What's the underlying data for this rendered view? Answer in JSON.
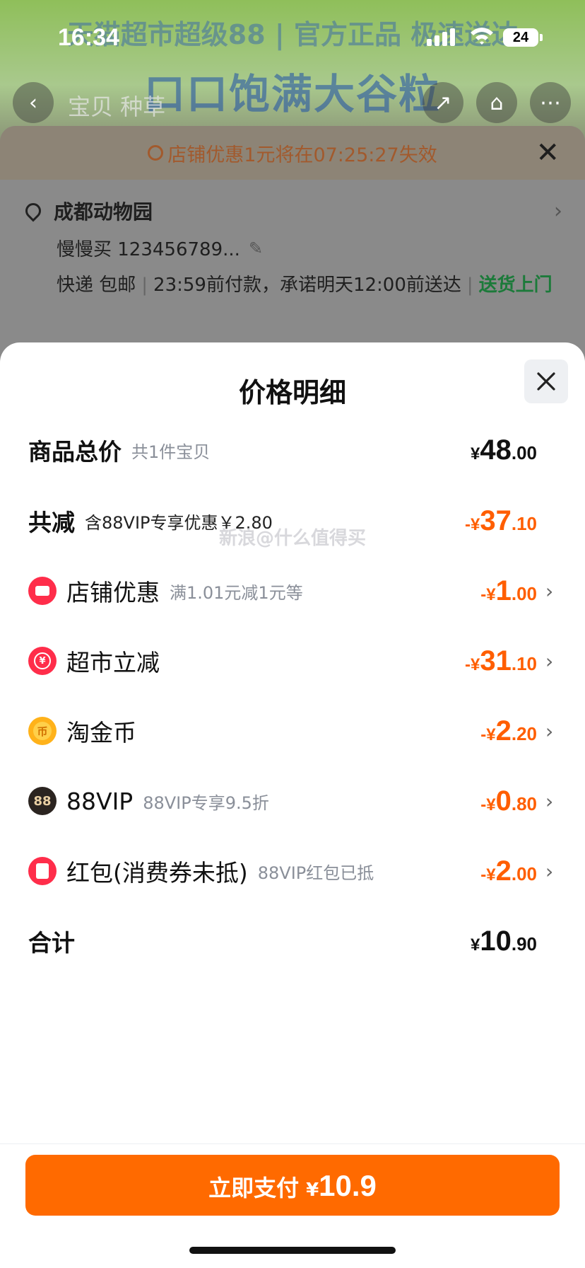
{
  "status_bar": {
    "time": "16:34",
    "battery": "24"
  },
  "background": {
    "banner_title": "天猫超市超级88 | 官方正品 极速送达",
    "banner_big": "口口饱满大谷粒",
    "tabs": "宝贝 种草",
    "timer_text": "店铺优惠1元将在07:25:27失效",
    "address_name": "成都动物园",
    "recipient": "慢慢买 123456789...",
    "delivery_mode": "快递 包邮",
    "delivery_promise": "23:59前付款，承诺明天12:00前送达",
    "delivery_extra": "送货上门"
  },
  "modal": {
    "title": "价格明细",
    "total_goods": {
      "label": "商品总价",
      "sub": "共1件宝贝",
      "yen": "¥",
      "int": "48",
      "dec": ".00"
    },
    "total_reduce": {
      "label": "共减",
      "sub": "含88VIP专享优惠￥2.80",
      "yen": "-¥",
      "int": "37",
      "dec": ".10"
    },
    "items": [
      {
        "label": "店铺优惠",
        "sub": "满1.01元减1元等",
        "yen": "-¥",
        "int": "1",
        "dec": ".00"
      },
      {
        "label": "超市立减",
        "sub": "",
        "yen": "-¥",
        "int": "31",
        "dec": ".10"
      },
      {
        "label": "淘金币",
        "sub": "",
        "yen": "-¥",
        "int": "2",
        "dec": ".20",
        "icon_text": "币"
      },
      {
        "label": "88VIP",
        "sub": "88VIP专享9.5折",
        "yen": "-¥",
        "int": "0",
        "dec": ".80",
        "icon_text": "88"
      },
      {
        "label": "红包(消费券未抵)",
        "sub": "88VIP红包已抵",
        "yen": "-¥",
        "int": "2",
        "dec": ".00"
      }
    ],
    "sum": {
      "label": "合计",
      "yen": "¥",
      "int": "10",
      "dec": ".90"
    },
    "watermark": "新浪@什么值得买"
  },
  "pay_button": {
    "label": "立即支付",
    "yen": "¥",
    "value": "10.9"
  },
  "colors": {
    "accent": "#ff6a00",
    "discount": "#ff5e00"
  },
  "icons": [
    "back-icon",
    "share-icon",
    "cart-icon",
    "more-icon",
    "clock-icon",
    "close-icon",
    "location-icon",
    "edit-icon",
    "chevron-right-icon",
    "shop-icon",
    "market-icon",
    "coin-icon",
    "vip-icon",
    "red-packet-icon"
  ]
}
